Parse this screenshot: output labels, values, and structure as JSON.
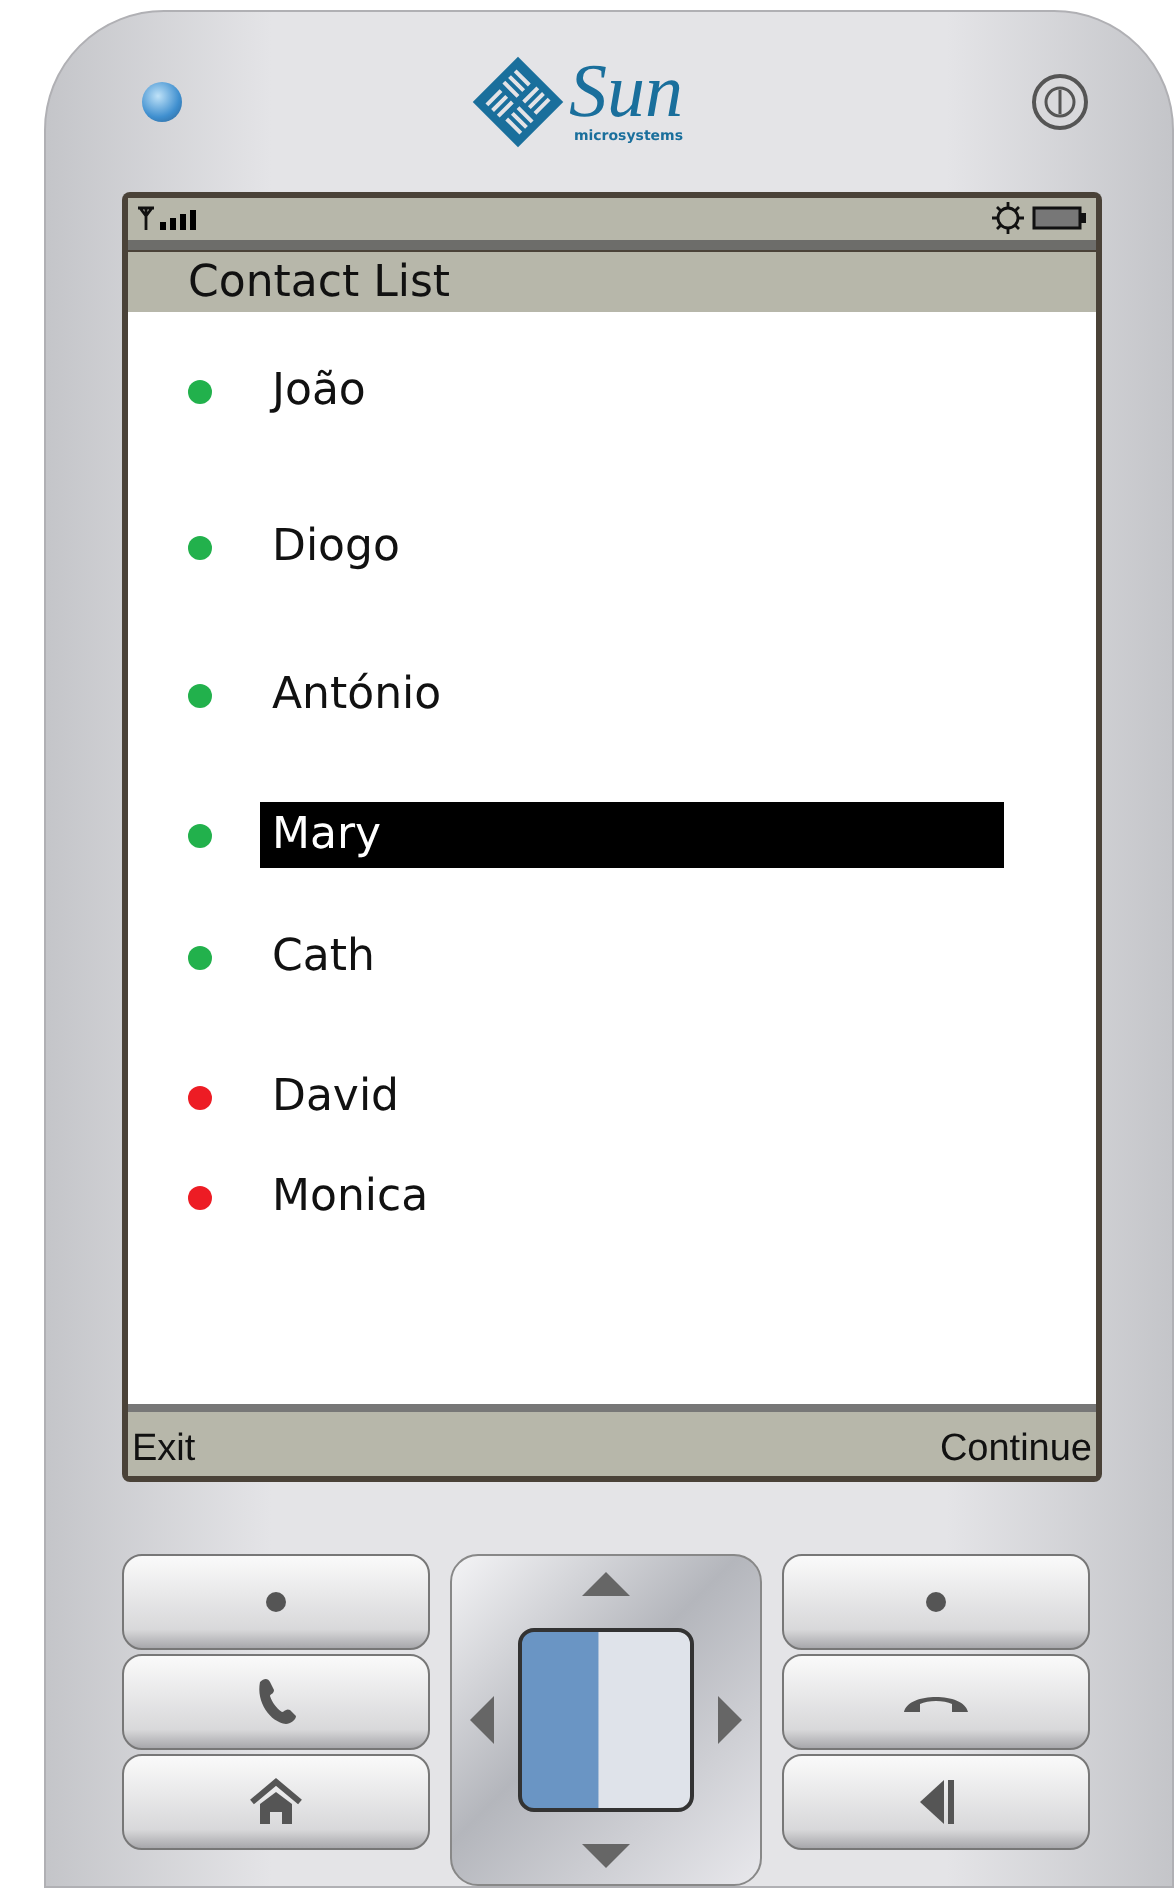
{
  "logo": {
    "name": "Sun",
    "tagline": "microsystems"
  },
  "screen": {
    "title": "Contact List"
  },
  "contacts": [
    {
      "name": "João",
      "color": "#22b14c",
      "selected": false
    },
    {
      "name": "Diogo",
      "color": "#22b14c",
      "selected": false
    },
    {
      "name": "António",
      "color": "#22b14c",
      "selected": false
    },
    {
      "name": "Mary",
      "color": "#22b14c",
      "selected": true
    },
    {
      "name": "Cath",
      "color": "#22b14c",
      "selected": false
    },
    {
      "name": "David",
      "color": "#ed1c24",
      "selected": false
    },
    {
      "name": "Monica",
      "color": "#ed1c24",
      "selected": false
    }
  ],
  "soft_keys": {
    "left": "Exit",
    "right": "Continue"
  }
}
